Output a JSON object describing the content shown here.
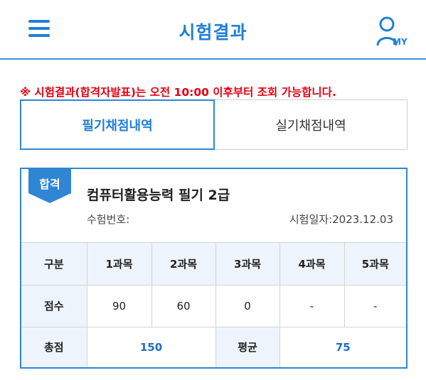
{
  "header": {
    "title": "시험결과",
    "menu_icon": "hamburger-menu-icon",
    "my_icon": "user-icon",
    "my_label": "MY"
  },
  "notice": {
    "prefix": "※ 시험결과(합격자발표)는 오전 ",
    "time": "10:00",
    "suffix": " 이후부터 조회 가능합니다."
  },
  "tabs": [
    {
      "label": "필기채점내역",
      "active": true
    },
    {
      "label": "실기채점내역",
      "active": false
    }
  ],
  "result": {
    "badge": "합격",
    "exam_name": "컴퓨터활용능력 필기 2급",
    "exam_number_label": "수험번호:",
    "exam_date_label": "시험일자:",
    "exam_date": "2023.12.03",
    "table": {
      "header": [
        "구분",
        "1과목",
        "2과목",
        "3과목",
        "4과목",
        "5과목"
      ],
      "score_row": [
        "점수",
        "90",
        "60",
        "0",
        "-",
        "-"
      ],
      "total_label": "총점",
      "total_value": "150",
      "average_label": "평균",
      "average_value": "75"
    }
  },
  "colors": {
    "accent": "#1f7fd6",
    "notice": "#e60012",
    "table_header_bg": "#eef4fb"
  }
}
